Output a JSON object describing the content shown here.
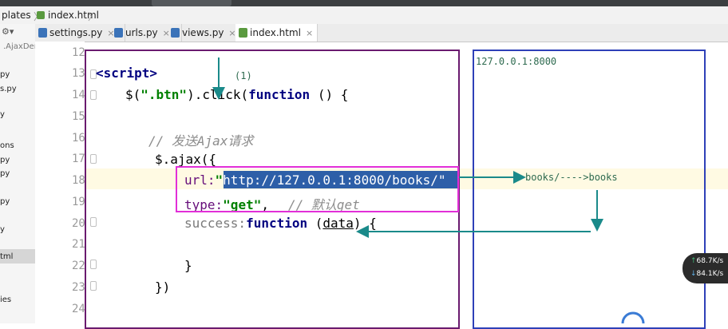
{
  "breadcrumb": {
    "folder": "plates",
    "file": "index.html"
  },
  "tabs": [
    {
      "label": "settings.py",
      "color": "#3b73b9",
      "active": false
    },
    {
      "label": "urls.py",
      "color": "#3b73b9",
      "active": false
    },
    {
      "label": "views.py",
      "color": "#3b73b9",
      "active": false
    },
    {
      "label": "index.html",
      "color": "#5a9a3f",
      "active": true
    }
  ],
  "tab_close": "×",
  "sidebar": {
    "items": [
      ".AjaxDer",
      "py",
      "s.py",
      "y",
      "ons",
      "py",
      "py",
      "py",
      "y",
      "tml",
      "ies"
    ]
  },
  "line_numbers": [
    "12",
    "13",
    "14",
    "15",
    "16",
    "17",
    "18",
    "19",
    "20",
    "21",
    "22",
    "23",
    "24"
  ],
  "code": {
    "l13": "<script>",
    "l14_pre": "$(",
    "l14_str": "\".btn\"",
    "l14_mid": ").click(",
    "l14_kw": "function",
    "l14_post": " () {",
    "l16_comment": "// 发送Ajax请求",
    "l17": "$.ajax({",
    "l18_key": "url:",
    "l18_q": "\"",
    "l18_val": "http://127.0.0.1:8000/books/\"",
    "l19_key": "type:",
    "l19_val": "\"get\"",
    "l19_comma": ",",
    "l19_comment": "// 默认get",
    "l20_key": "success:",
    "l20_kw": "function",
    "l20_arg": "data",
    "l20_post": ") {",
    "l22": "}",
    "l23": "})"
  },
  "annotations": {
    "step": "(1)",
    "host": "127.0.0.1:8000",
    "route": "books/---->books"
  },
  "network": {
    "up": "68.7K/s",
    "down": "84.1K/s"
  },
  "colors": {
    "purple_box": "#6a1b6f",
    "pink_box": "#e22fd8",
    "blue_box": "#2e40b8",
    "arrow": "#1a8a8a"
  }
}
